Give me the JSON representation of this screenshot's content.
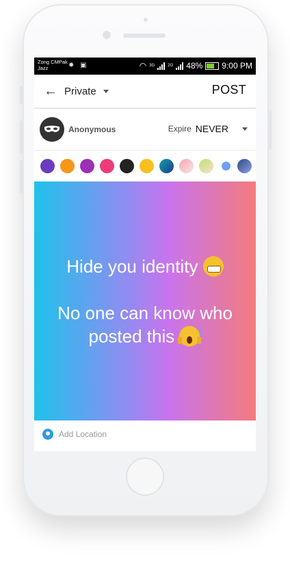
{
  "status_bar": {
    "carrier_line1": "Zong CMPak",
    "carrier_line2": "Jazz",
    "net1": "3G",
    "net2": "2G",
    "battery": "48%",
    "time": "9:00 PM"
  },
  "header": {
    "privacy": "Private",
    "post_label": "POST"
  },
  "user": {
    "name": "Anonymous",
    "expire_label": "Expire",
    "expire_value": "NEVER"
  },
  "colors": [
    "#6c3bbf",
    "#f7961b",
    "#9c2fb5",
    "#ee3a79",
    "#222222",
    "#f6c020",
    "linear-gradient(135deg,#12a0a6,#1c3c8c)",
    "linear-gradient(135deg,#f1a7ae,#fbe4e6)",
    "linear-gradient(135deg,#b9e27c,#fbe0c4)",
    "#6f9ff5",
    "linear-gradient(135deg,#2b4b88,#8f9ee0)"
  ],
  "post": {
    "line1": "Hide you identity",
    "line2": "No one can know who",
    "line3": "posted this"
  },
  "location": {
    "placeholder": "Add Location"
  }
}
